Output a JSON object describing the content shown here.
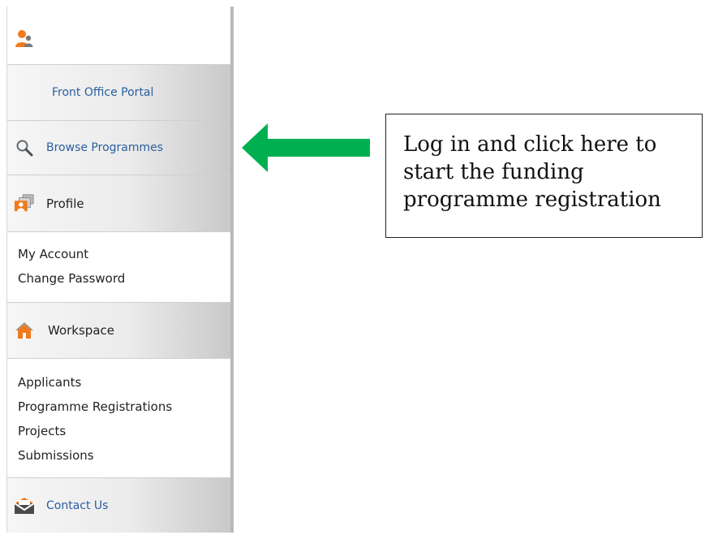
{
  "sidebar": {
    "user_icon": "user-silhouette-icon",
    "front_office": {
      "label": "Front Office Portal"
    },
    "browse": {
      "label": "Browse Programmes",
      "icon": "magnifier-icon"
    },
    "profile": {
      "label": "Profile",
      "icon": "profile-cards-icon",
      "items": [
        "My Account",
        "Change Password"
      ]
    },
    "workspace": {
      "label": "Workspace",
      "icon": "house-icon",
      "items": [
        "Applicants",
        "Programme Registrations",
        "Projects",
        "Submissions"
      ]
    },
    "contact": {
      "label": "Contact Us",
      "icon": "envelope-icon"
    }
  },
  "annotation": {
    "line1": "Log in and click here to",
    "line2": "start the funding",
    "line3": "programme registration",
    "arrow_color": "#00b050",
    "arrow_icon": "left-arrow"
  },
  "colors": {
    "link": "#2a5f9e",
    "accent_orange": "#f07b1c"
  }
}
